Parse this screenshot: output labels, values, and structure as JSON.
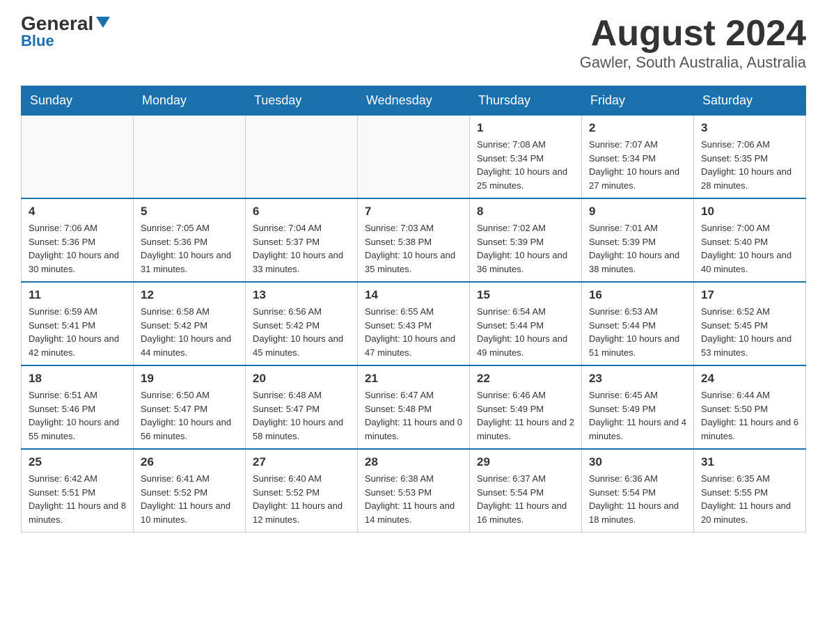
{
  "header": {
    "logo_general": "General",
    "logo_blue": "Blue",
    "month_year": "August 2024",
    "location": "Gawler, South Australia, Australia"
  },
  "days_of_week": [
    "Sunday",
    "Monday",
    "Tuesday",
    "Wednesday",
    "Thursday",
    "Friday",
    "Saturday"
  ],
  "weeks": [
    [
      {
        "day": "",
        "info": ""
      },
      {
        "day": "",
        "info": ""
      },
      {
        "day": "",
        "info": ""
      },
      {
        "day": "",
        "info": ""
      },
      {
        "day": "1",
        "info": "Sunrise: 7:08 AM\nSunset: 5:34 PM\nDaylight: 10 hours and 25 minutes."
      },
      {
        "day": "2",
        "info": "Sunrise: 7:07 AM\nSunset: 5:34 PM\nDaylight: 10 hours and 27 minutes."
      },
      {
        "day": "3",
        "info": "Sunrise: 7:06 AM\nSunset: 5:35 PM\nDaylight: 10 hours and 28 minutes."
      }
    ],
    [
      {
        "day": "4",
        "info": "Sunrise: 7:06 AM\nSunset: 5:36 PM\nDaylight: 10 hours and 30 minutes."
      },
      {
        "day": "5",
        "info": "Sunrise: 7:05 AM\nSunset: 5:36 PM\nDaylight: 10 hours and 31 minutes."
      },
      {
        "day": "6",
        "info": "Sunrise: 7:04 AM\nSunset: 5:37 PM\nDaylight: 10 hours and 33 minutes."
      },
      {
        "day": "7",
        "info": "Sunrise: 7:03 AM\nSunset: 5:38 PM\nDaylight: 10 hours and 35 minutes."
      },
      {
        "day": "8",
        "info": "Sunrise: 7:02 AM\nSunset: 5:39 PM\nDaylight: 10 hours and 36 minutes."
      },
      {
        "day": "9",
        "info": "Sunrise: 7:01 AM\nSunset: 5:39 PM\nDaylight: 10 hours and 38 minutes."
      },
      {
        "day": "10",
        "info": "Sunrise: 7:00 AM\nSunset: 5:40 PM\nDaylight: 10 hours and 40 minutes."
      }
    ],
    [
      {
        "day": "11",
        "info": "Sunrise: 6:59 AM\nSunset: 5:41 PM\nDaylight: 10 hours and 42 minutes."
      },
      {
        "day": "12",
        "info": "Sunrise: 6:58 AM\nSunset: 5:42 PM\nDaylight: 10 hours and 44 minutes."
      },
      {
        "day": "13",
        "info": "Sunrise: 6:56 AM\nSunset: 5:42 PM\nDaylight: 10 hours and 45 minutes."
      },
      {
        "day": "14",
        "info": "Sunrise: 6:55 AM\nSunset: 5:43 PM\nDaylight: 10 hours and 47 minutes."
      },
      {
        "day": "15",
        "info": "Sunrise: 6:54 AM\nSunset: 5:44 PM\nDaylight: 10 hours and 49 minutes."
      },
      {
        "day": "16",
        "info": "Sunrise: 6:53 AM\nSunset: 5:44 PM\nDaylight: 10 hours and 51 minutes."
      },
      {
        "day": "17",
        "info": "Sunrise: 6:52 AM\nSunset: 5:45 PM\nDaylight: 10 hours and 53 minutes."
      }
    ],
    [
      {
        "day": "18",
        "info": "Sunrise: 6:51 AM\nSunset: 5:46 PM\nDaylight: 10 hours and 55 minutes."
      },
      {
        "day": "19",
        "info": "Sunrise: 6:50 AM\nSunset: 5:47 PM\nDaylight: 10 hours and 56 minutes."
      },
      {
        "day": "20",
        "info": "Sunrise: 6:48 AM\nSunset: 5:47 PM\nDaylight: 10 hours and 58 minutes."
      },
      {
        "day": "21",
        "info": "Sunrise: 6:47 AM\nSunset: 5:48 PM\nDaylight: 11 hours and 0 minutes."
      },
      {
        "day": "22",
        "info": "Sunrise: 6:46 AM\nSunset: 5:49 PM\nDaylight: 11 hours and 2 minutes."
      },
      {
        "day": "23",
        "info": "Sunrise: 6:45 AM\nSunset: 5:49 PM\nDaylight: 11 hours and 4 minutes."
      },
      {
        "day": "24",
        "info": "Sunrise: 6:44 AM\nSunset: 5:50 PM\nDaylight: 11 hours and 6 minutes."
      }
    ],
    [
      {
        "day": "25",
        "info": "Sunrise: 6:42 AM\nSunset: 5:51 PM\nDaylight: 11 hours and 8 minutes."
      },
      {
        "day": "26",
        "info": "Sunrise: 6:41 AM\nSunset: 5:52 PM\nDaylight: 11 hours and 10 minutes."
      },
      {
        "day": "27",
        "info": "Sunrise: 6:40 AM\nSunset: 5:52 PM\nDaylight: 11 hours and 12 minutes."
      },
      {
        "day": "28",
        "info": "Sunrise: 6:38 AM\nSunset: 5:53 PM\nDaylight: 11 hours and 14 minutes."
      },
      {
        "day": "29",
        "info": "Sunrise: 6:37 AM\nSunset: 5:54 PM\nDaylight: 11 hours and 16 minutes."
      },
      {
        "day": "30",
        "info": "Sunrise: 6:36 AM\nSunset: 5:54 PM\nDaylight: 11 hours and 18 minutes."
      },
      {
        "day": "31",
        "info": "Sunrise: 6:35 AM\nSunset: 5:55 PM\nDaylight: 11 hours and 20 minutes."
      }
    ]
  ]
}
